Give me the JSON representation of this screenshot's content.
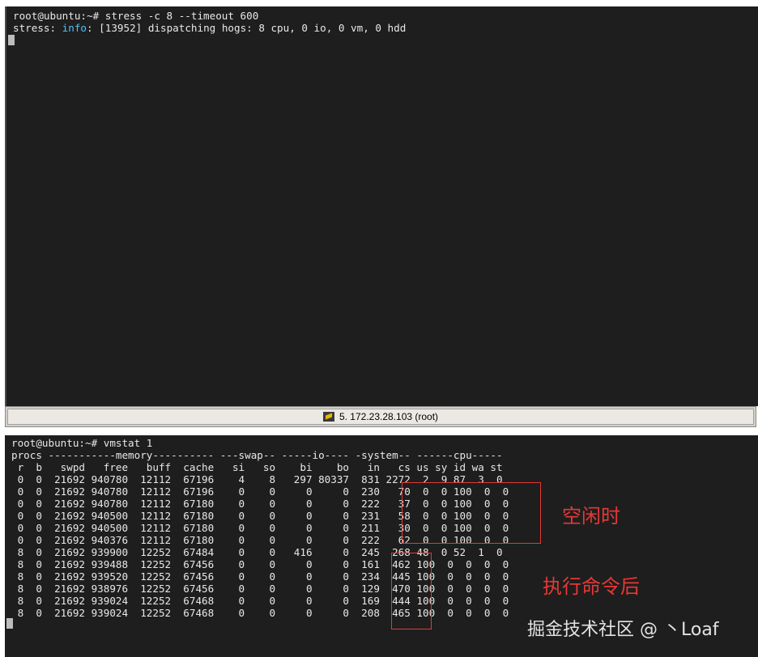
{
  "top_terminal": {
    "command_line": "root@ubuntu:~# stress -c 8 --timeout 600",
    "output": {
      "prefix": "stress: ",
      "level": "info",
      "rest": ": [13952] dispatching hogs: 8 cpu, 0 io, 0 vm, 0 hdd"
    }
  },
  "status_bar": {
    "tab_icon": "terminal-icon",
    "label": "5. 172.23.28.103 (root)"
  },
  "bottom_terminal": {
    "command_line": "root@ubuntu:~# vmstat 1",
    "lines": [
      "procs -----------memory---------- ---swap-- -----io---- -system-- ------cpu-----",
      " r  b   swpd   free   buff  cache   si   so    bi    bo   in   cs us sy id wa st",
      " 0  0  21692 940780  12112  67196    4    8   297 80337  831 2272  2  9 87  3  0",
      " 0  0  21692 940780  12112  67196    0    0     0     0  230   70  0  0 100  0  0",
      " 0  0  21692 940780  12112  67180    0    0     0     0  222   37  0  0 100  0  0",
      " 0  0  21692 940500  12112  67180    0    0     0     0  231   58  0  0 100  0  0",
      " 0  0  21692 940500  12112  67180    0    0     0     0  211   30  0  0 100  0  0",
      " 0  0  21692 940376  12112  67180    0    0     0     0  222   62  0  0 100  0  0",
      " 8  0  21692 939900  12252  67484    0    0   416     0  245  268 48  0 52  1  0",
      " 8  0  21692 939488  12252  67456    0    0     0     0  161  462 100  0  0  0  0",
      " 8  0  21692 939520  12252  67456    0    0     0     0  234  445 100  0  0  0  0",
      " 8  0  21692 938976  12252  67456    0    0     0     0  129  470 100  0  0  0  0",
      " 8  0  21692 939024  12252  67468    0    0     0     0  169  444 100  0  0  0  0",
      " 8  0  21692 939024  12252  67468    0    0     0     0  208  465 100  0  0  0  0"
    ]
  },
  "annotations": {
    "idle_label": "空闲时",
    "after_label": "执行命令后"
  },
  "watermark": "掘金技术社区 @ 丶Loaf",
  "colors": {
    "terminal_bg": "#1e1e1e",
    "highlight": "#4fc3f7",
    "annotation": "#e53935"
  }
}
